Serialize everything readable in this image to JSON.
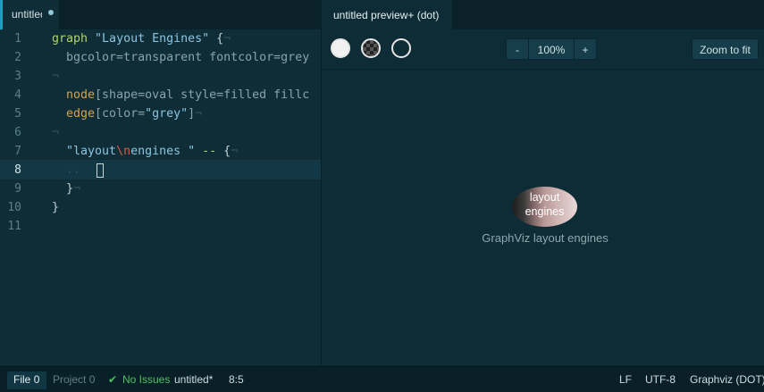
{
  "editor": {
    "tab_title": "untitled",
    "line_numbers": [
      "1",
      "2",
      "3",
      "4",
      "5",
      "6",
      "7",
      "8",
      "9",
      "10",
      "11"
    ],
    "current_line": 8,
    "lines": {
      "l1_kw": "graph",
      "l1_str": "\"Layout Engines\"",
      "l1_brace": " {",
      "l2_indent": "  ",
      "l2_text": "bgcolor=transparent fontcolor=grey",
      "l4_indent": "  ",
      "l4_node": "node",
      "l4_rest": "[shape=oval style=filled fillc",
      "l5_indent": "  ",
      "l5_edge": "edge",
      "l5_open": "[color=",
      "l5_str": "\"grey\"",
      "l5_close": "]",
      "l7_indent": "  ",
      "l7_str_a": "\"layout",
      "l7_esc": "\\n",
      "l7_str_b": "engines \"",
      "l7_op": " -- ",
      "l7_brace": "{",
      "l8_indent": "  ··  ",
      "l9_brace": "  }",
      "l10_brace": "}",
      "eol_mark": "¬"
    }
  },
  "preview": {
    "tab_title": "untitled preview+ (dot)",
    "bg_options": [
      "white",
      "checker",
      "transparent"
    ],
    "zoom_out_label": "-",
    "zoom_level": "100%",
    "zoom_in_label": "+",
    "zoom_fit_label": "Zoom to fit",
    "node_label_line1": "layout",
    "node_label_line2": "engines",
    "graph_label": "GraphViz layout engines"
  },
  "status": {
    "file_label": "File",
    "file_count": "0",
    "project_label": "Project",
    "project_count": "0",
    "issues_label": "No Issues",
    "filename": "untitled*",
    "cursor": "8:5",
    "eol": "LF",
    "encoding": "UTF-8",
    "grammar": "Graphviz (DOT)"
  },
  "colors": {
    "background": "#0e2d36",
    "accent": "#1aa0c4",
    "ok": "#4ec15e"
  }
}
